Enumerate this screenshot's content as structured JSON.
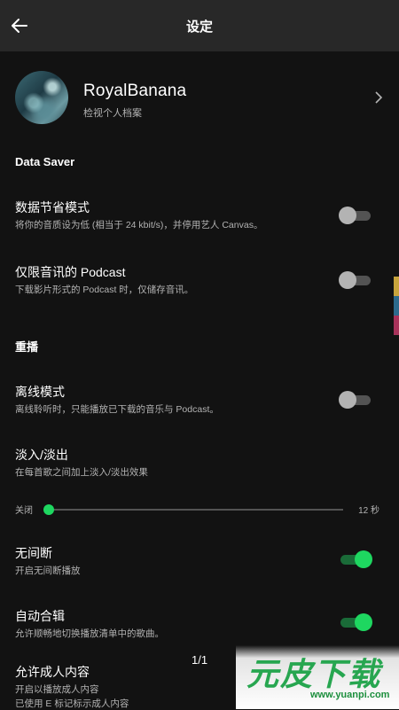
{
  "header": {
    "title": "设定"
  },
  "profile": {
    "name": "RoyalBanana",
    "subtitle": "检视个人档案"
  },
  "sections": {
    "data_saver": "Data Saver",
    "playback": "重播"
  },
  "settings": {
    "data_saver_mode": {
      "title": "数据节省模式",
      "subtitle": "将你的音质设为低 (相当于 24 kbit/s)，并停用艺人 Canvas。",
      "enabled": false
    },
    "podcast_audio_only": {
      "title": "仅限音讯的 Podcast",
      "subtitle": "下载影片形式的 Podcast 时，仅储存音讯。",
      "enabled": false
    },
    "offline_mode": {
      "title": "离线模式",
      "subtitle": "离线聆听时，只能播放已下载的音乐与 Podcast。",
      "enabled": false
    },
    "crossfade": {
      "title": "淡入/淡出",
      "subtitle": "在每首歌之间加上淡入/淡出效果",
      "min_label": "关闭",
      "max_label": "12 秒",
      "value_fraction": 0.0
    },
    "gapless": {
      "title": "无间断",
      "subtitle": "开启无间断播放",
      "enabled": true
    },
    "automix": {
      "title": "自动合辑",
      "subtitle": "允许顺畅地切换播放清单中的歌曲。",
      "enabled": true
    },
    "explicit": {
      "title": "允许成人内容",
      "subtitle": "开启以播放成人内容",
      "subtitle2": "已使用 E 标记标示成人内容"
    }
  },
  "page_indicator": "1/1",
  "watermark": {
    "text": "元皮下载",
    "url": "www.yuanpi.com"
  },
  "colors": {
    "accent": "#1ed760",
    "background": "#121212",
    "header": "#282828",
    "secondary_text": "#b3b3b3"
  },
  "icons": {
    "back": "arrow-left-icon",
    "profile_chevron": "chevron-right-icon"
  }
}
